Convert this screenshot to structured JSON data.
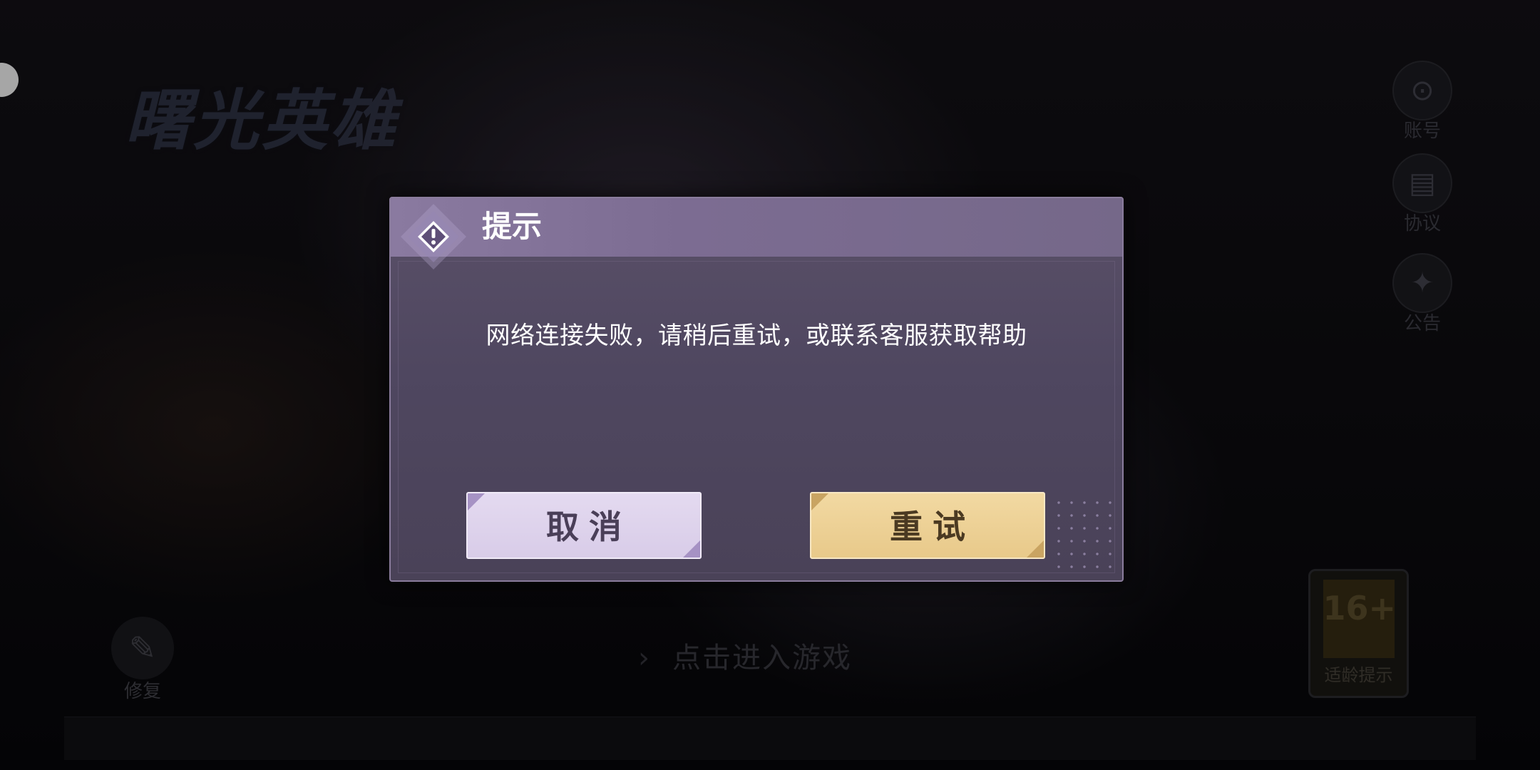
{
  "background": {
    "logo_text": "曙光英雄",
    "side_buttons": [
      {
        "label": "账号",
        "icon": "account-icon",
        "glyph": "⊙"
      },
      {
        "label": "协议",
        "icon": "document-icon",
        "glyph": "▤"
      },
      {
        "label": "公告",
        "icon": "megaphone-icon",
        "glyph": "✦"
      }
    ],
    "repair": {
      "label": "修复",
      "icon": "wrench-icon",
      "glyph": "✎"
    },
    "enter_game": {
      "label": "点击进入游戏",
      "icon": "chevron-right-icon",
      "glyph": "›"
    },
    "age_rating": {
      "value": "16+",
      "label": "适龄提示"
    }
  },
  "dialog": {
    "title": "提示",
    "message": "网络连接失败，请稍后重试，或联系客服获取帮助",
    "cancel_label": "取消",
    "retry_label": "重试",
    "colors": {
      "header": "#7c6c92",
      "body": "#4f4760",
      "cancel_bg": "#dcd0ea",
      "retry_bg": "#edd195"
    }
  }
}
